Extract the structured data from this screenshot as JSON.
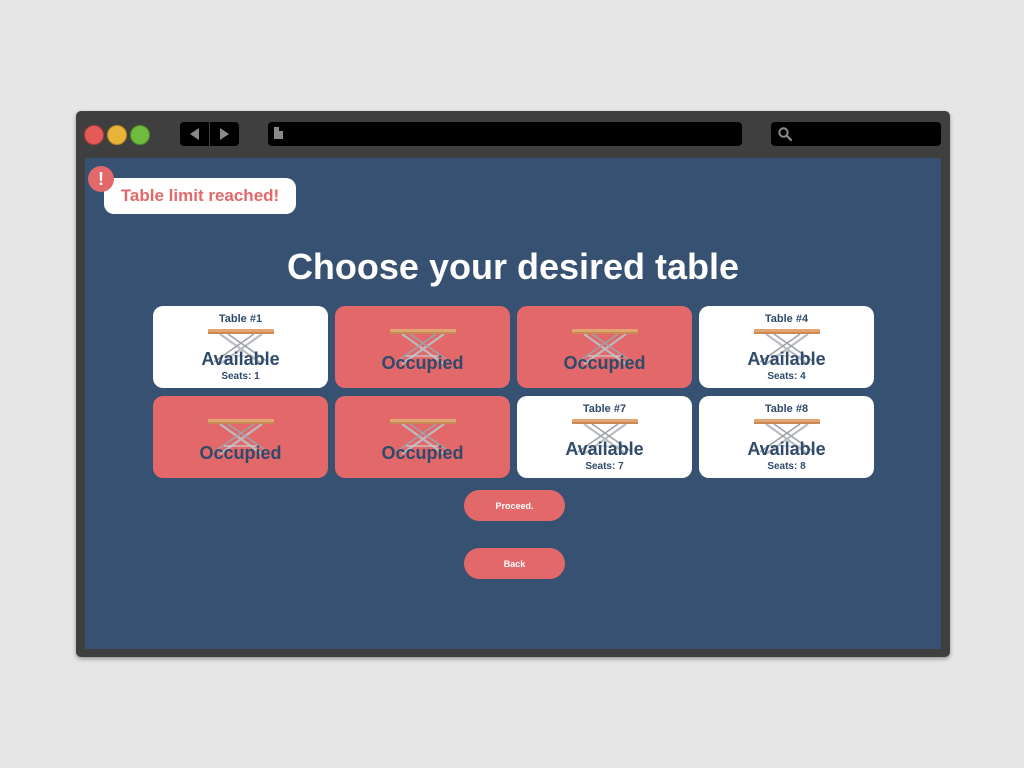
{
  "alert": {
    "text": "Table limit reached!",
    "badge": "!"
  },
  "heading": "Choose your desired table",
  "tables": [
    {
      "name": "Table #1",
      "status": "Available",
      "seats": "Seats: 1"
    },
    {
      "name": "",
      "status": "Occupied",
      "seats": ""
    },
    {
      "name": "",
      "status": "Occupied",
      "seats": ""
    },
    {
      "name": "Table #4",
      "status": "Available",
      "seats": "Seats: 4"
    },
    {
      "name": "",
      "status": "Occupied",
      "seats": ""
    },
    {
      "name": "",
      "status": "Occupied",
      "seats": ""
    },
    {
      "name": "Table #7",
      "status": "Available",
      "seats": "Seats: 7"
    },
    {
      "name": "Table #8",
      "status": "Available",
      "seats": "Seats: 8"
    }
  ],
  "buttons": {
    "proceed": "Proceed.",
    "back": "Back"
  },
  "colors": {
    "background": "#365171",
    "accent": "#e3686a",
    "card_available": "#ffffff",
    "text_dark": "#2f4a6b"
  },
  "icons": {
    "alert": "exclamation-icon",
    "table": "table-icon",
    "back": "back-arrow-icon",
    "forward": "forward-arrow-icon",
    "page": "file-icon",
    "search": "search-icon"
  }
}
